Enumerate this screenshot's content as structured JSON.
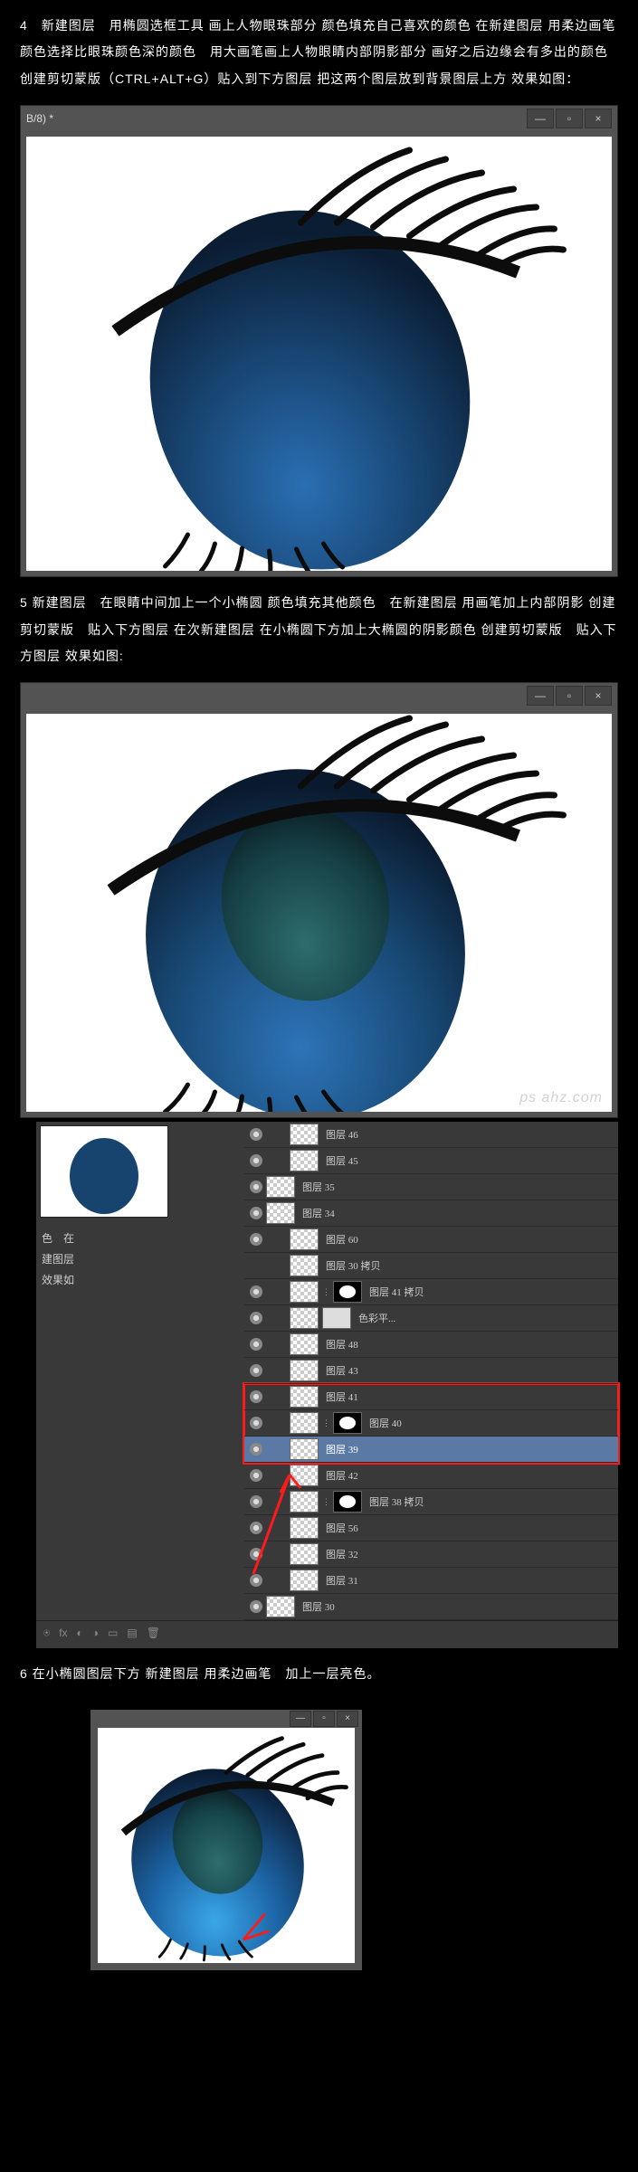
{
  "step4": {
    "heading": "4　新建图层　用椭圆选框工具 画上人物眼珠部分 颜色填充自己喜欢的颜色 在新建图层 用柔边画笔 颜色选择比眼珠颜色深的颜色　用大画笔画上人物眼睛内部阴影部分 画好之后边缘会有多出的颜色 创建剪切蒙版（CTRL+ALT+G）贴入到下方图层 把这两个图层放到背景图层上方 效果如图：",
    "tab_label": "B/8) *",
    "win_minimize": "—",
    "win_restore": "▫",
    "win_close": "×"
  },
  "step5": {
    "heading": "5 新建图层　在眼睛中间加上一个小椭圆 颜色填充其他颜色　在新建图层 用画笔加上内部阴影 创建剪切蒙版　贴入下方图层 在次新建图层 在小椭圆下方加上大椭圆的阴影颜色 创建剪切蒙版　贴入下方图层 效果如图:",
    "side_text_1": "色　在",
    "side_text_2": "建图层",
    "side_text_3": "效果如",
    "layers": [
      {
        "name": "图层 46",
        "eye": true,
        "indent": 1
      },
      {
        "name": "图层 45",
        "eye": true,
        "indent": 1
      },
      {
        "name": "图层 35",
        "eye": true,
        "indent": 0
      },
      {
        "name": "图层 34",
        "eye": true,
        "indent": 0
      },
      {
        "name": "图层 60",
        "eye": true,
        "indent": 1
      },
      {
        "name": "图层 30 拷贝",
        "eye": false,
        "indent": 1
      },
      {
        "name": "图层 41 拷贝",
        "eye": true,
        "indent": 1,
        "mask": true
      },
      {
        "name": "色彩平...",
        "eye": true,
        "indent": 1,
        "adjustment": true
      },
      {
        "name": "图层 48",
        "eye": true,
        "indent": 1
      },
      {
        "name": "图层 43",
        "eye": true,
        "indent": 1
      },
      {
        "name": "图层 41",
        "eye": true,
        "indent": 1,
        "boxed": true
      },
      {
        "name": "图层 40",
        "eye": true,
        "indent": 1,
        "mask": true,
        "boxed": true
      },
      {
        "name": "图层 39",
        "eye": true,
        "indent": 1,
        "sel": true,
        "boxed": true
      },
      {
        "name": "图层 42",
        "eye": true,
        "indent": 1
      },
      {
        "name": "图层 38 拷贝",
        "eye": true,
        "indent": 1,
        "mask": true
      },
      {
        "name": "图层 56",
        "eye": true,
        "indent": 1
      },
      {
        "name": "图层 32",
        "eye": true,
        "indent": 1
      },
      {
        "name": "图层 31",
        "eye": true,
        "indent": 1
      },
      {
        "name": "图层 30",
        "eye": true,
        "indent": 0
      }
    ],
    "footer_icons": [
      "fx",
      "fx",
      "⬡",
      "◐",
      "◻",
      "▢",
      "🗑"
    ]
  },
  "step6": {
    "heading": "6 在小椭圆图层下方 新建图层 用柔边画笔　加上一层亮色。"
  },
  "watermark": "ps ahz.com",
  "win": {
    "min": "—",
    "res": "▫",
    "close": "×"
  }
}
